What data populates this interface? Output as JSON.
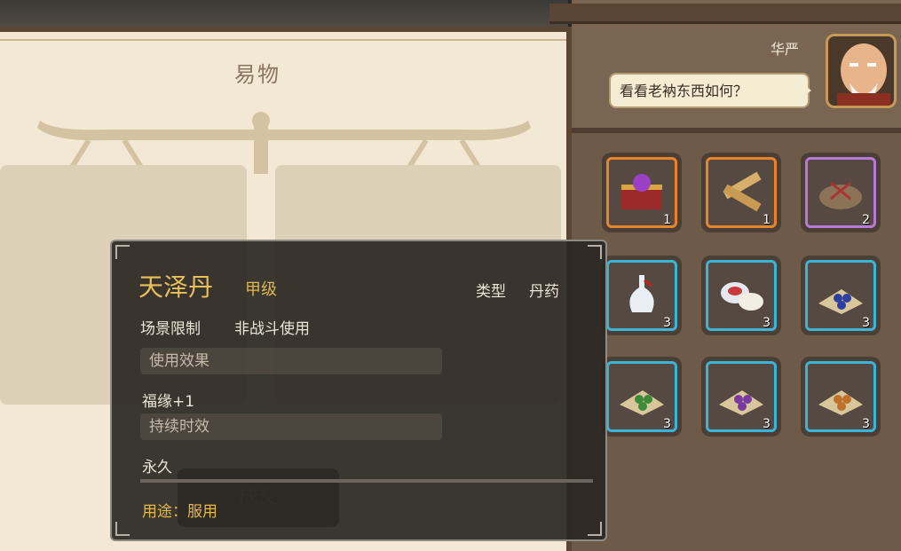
{
  "trade_panel": {
    "title": "易物",
    "deal_button": "成交"
  },
  "npc": {
    "name": "华严",
    "dialogue": "看看老衲东西如何？"
  },
  "inventory": [
    {
      "icon": "treasure-chest-icon",
      "qty": "1",
      "rarity": "orange"
    },
    {
      "icon": "bamboo-scroll-icon",
      "qty": "1",
      "rarity": "orange"
    },
    {
      "icon": "cloth-bundle-icon",
      "qty": "2",
      "rarity": "purple"
    },
    {
      "icon": "wine-bottle-icon",
      "qty": "3",
      "rarity": "blue"
    },
    {
      "icon": "porcelain-dish-icon",
      "qty": "3",
      "rarity": "blue"
    },
    {
      "icon": "blue-pills-icon",
      "qty": "3",
      "rarity": "blue"
    },
    {
      "icon": "green-pills-icon",
      "qty": "3",
      "rarity": "blue"
    },
    {
      "icon": "purple-pills-icon",
      "qty": "3",
      "rarity": "blue"
    },
    {
      "icon": "orange-pills-icon",
      "qty": "3",
      "rarity": "blue"
    }
  ],
  "tooltip": {
    "name": "天泽丹",
    "grade": "甲级",
    "type_label": "类型",
    "type_value": "丹药",
    "scene_label": "场景限制",
    "scene_value": "非战斗使用",
    "effect_header": "使用效果",
    "effect_value": "福缘+1",
    "duration_header": "持续时效",
    "duration_value": "永久",
    "usage": "用途：服用"
  },
  "colors": {
    "paper": "#f2e8d3",
    "wood": "#6e5a48",
    "gold": "#e9c15a",
    "orange_rarity": "#e8852a",
    "blue_rarity": "#3ab5d8",
    "purple_rarity": "#b77ad6"
  }
}
